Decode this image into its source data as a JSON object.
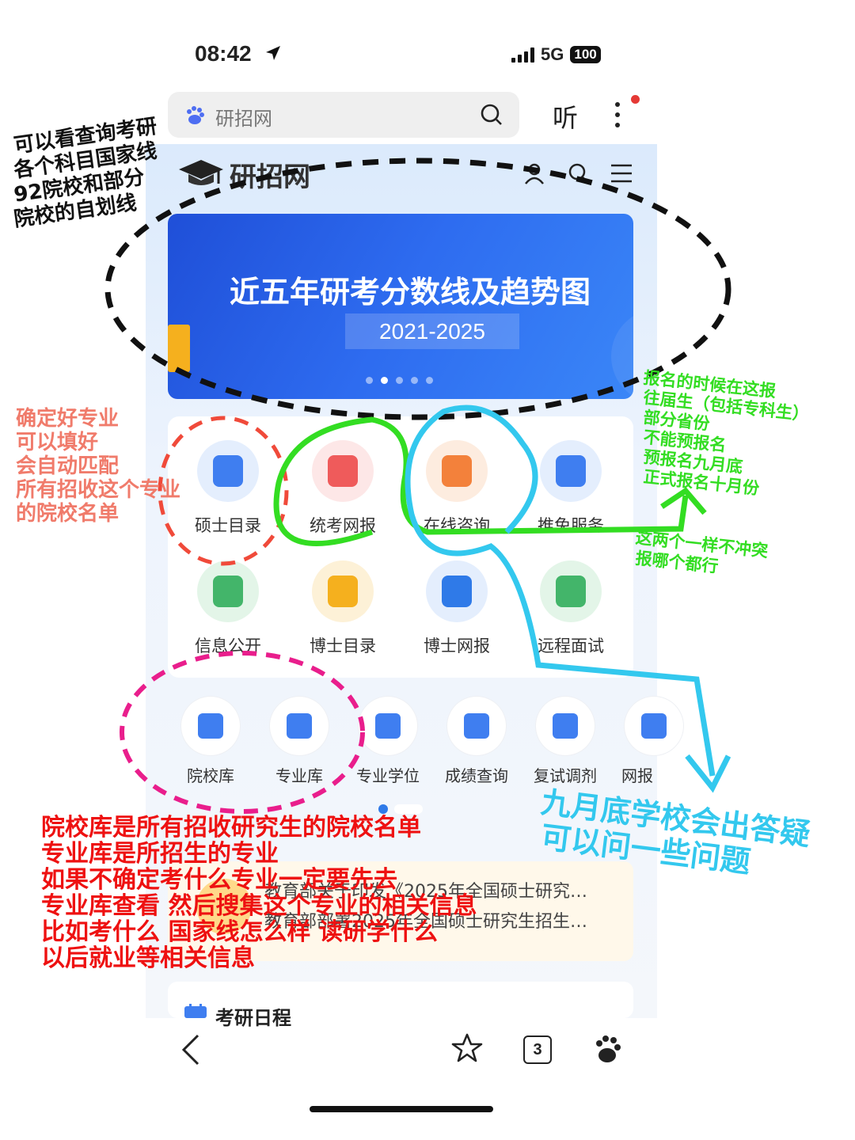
{
  "status": {
    "time": "08:42",
    "network": "5G",
    "battery": "100"
  },
  "browser": {
    "search_text": "研招网",
    "listen_label": "听"
  },
  "site": {
    "title": "研招网"
  },
  "banner": {
    "title": "近五年研考分数线及趋势图",
    "subtitle": "2021-2025"
  },
  "grid": [
    {
      "label": "硕士目录",
      "color": "#3f7ef0",
      "bg": "#e4eefd"
    },
    {
      "label": "统考网报",
      "color": "#ef5b5b",
      "bg": "#fde7e7"
    },
    {
      "label": "在线咨询",
      "color": "#f3813b",
      "bg": "#fdecdf"
    },
    {
      "label": "推免服务",
      "color": "#3f7ef0",
      "bg": "#e4eefd"
    },
    {
      "label": "信息公开",
      "color": "#43b56a",
      "bg": "#e3f5e8"
    },
    {
      "label": "博士目录",
      "color": "#f5b01e",
      "bg": "#fdf1d7"
    },
    {
      "label": "博士网报",
      "color": "#2f7ae8",
      "bg": "#e4eefd"
    },
    {
      "label": "远程面试",
      "color": "#43b56a",
      "bg": "#e3f5e8"
    }
  ],
  "quick": [
    {
      "label": "院校库"
    },
    {
      "label": "专业库"
    },
    {
      "label": "专业学位"
    },
    {
      "label": "成绩查询"
    },
    {
      "label": "复试调剂"
    },
    {
      "label": "网报"
    }
  ],
  "news": [
    "教育部关于印发《2025年全国硕士研究…",
    "教育部部署2025年全国硕士研究生招生…"
  ],
  "schedule_title": "考研日程",
  "tab_count": "3",
  "annotations": {
    "black": [
      "可以看查询考研",
      "各个科目国家线",
      "92院校和部分",
      "院校的自划线"
    ],
    "salmon": [
      "确定好专业",
      "可以填好",
      "会自动匹配",
      "所有招收这个专业",
      "的院校名单"
    ],
    "green": [
      "报名的时候在这报",
      "往届生（包括专科生）",
      "部分省份",
      "不能预报名",
      "预报名九月底",
      "正式报名十月份"
    ],
    "green2": [
      "这两个一样不冲突",
      "报哪个都行"
    ],
    "cyan": [
      "九月底学校会出答疑",
      "可以问一些问题"
    ],
    "red": [
      "院校库是所有招收研究生的院校名单",
      "专业库是所招生的专业",
      "如果不确定考什么专业一定要先去",
      "专业库查看 然后搜集这个专业的相关信息",
      "比如考什么 国家线怎么样 读研学什么",
      "以后就业等相关信息"
    ]
  },
  "colors": {
    "black_note": "#111111",
    "salmon_note": "#f07b6b",
    "green_note": "#33dd22",
    "cyan_note": "#33c8ee",
    "red_note": "#ee1111",
    "magenta_note": "#e91e8c"
  }
}
